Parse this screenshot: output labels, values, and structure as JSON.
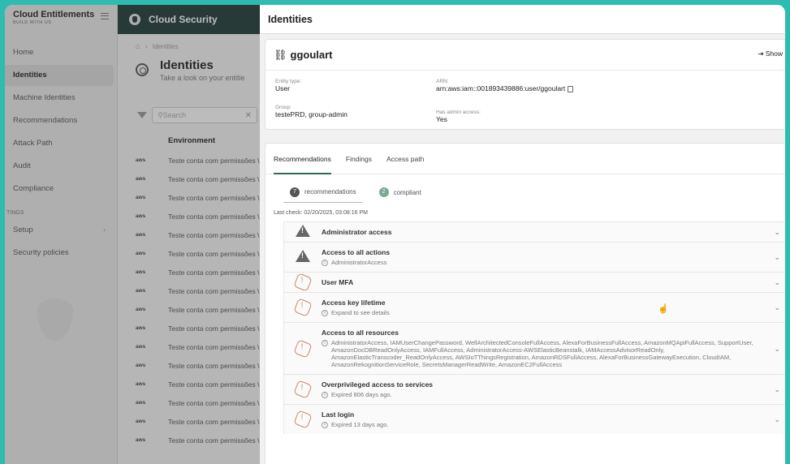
{
  "sidebar": {
    "brand_title": "Cloud Entitlements",
    "brand_subtitle": "BUILD WITH US",
    "items": [
      {
        "label": "Home"
      },
      {
        "label": "Identities"
      },
      {
        "label": "Machine Identities"
      },
      {
        "label": "Recommendations"
      },
      {
        "label": "Attack Path"
      },
      {
        "label": "Audit"
      },
      {
        "label": "Compliance"
      }
    ],
    "section_label": "TINGS",
    "setup_label": "Setup",
    "security_label": "Security policies"
  },
  "middle": {
    "header_title": "Cloud Security",
    "breadcrumb": "Identities",
    "page_title": "Identities",
    "page_subtitle": "Take a look on your entitie",
    "search_placeholder": "Search",
    "column_header": "Environment",
    "row_provider": "aws",
    "row_text": "Teste conta com permissões \\",
    "row_count": 16
  },
  "drawer": {
    "title": "Identities",
    "entity_name": "ggoulart",
    "show_button": "⇥ Show",
    "entity_type_label": "Entity type:",
    "entity_type": "User",
    "arn_label": "ARN:",
    "arn": "arn:aws:iam::001893439886:user/ggoulart",
    "group_label": "Group:",
    "group": "testePRD, group-admin",
    "admin_label": "Has admin access:",
    "admin": "Yes",
    "tabs": [
      "Recommendations",
      "Findings",
      "Access path"
    ],
    "pill_recommendations_count": "7",
    "pill_recommendations_label": "recommendations",
    "pill_compliant_count": "2",
    "pill_compliant_label": "compliant",
    "last_check": "Last check: 02/20/2025, 03:08:16 PM",
    "recommendations": [
      {
        "title": "Administrator access",
        "subtitle": "",
        "icon": "warning-icon"
      },
      {
        "title": "Access to all actions",
        "subtitle": "AdministratorAccess",
        "icon": "warning-icon"
      },
      {
        "title": "User MFA",
        "subtitle": "",
        "icon": "alert-octagon-icon"
      },
      {
        "title": "Access key lifetime",
        "subtitle": "Expand to see details",
        "icon": "alert-octagon-icon"
      },
      {
        "title": "Access to all resources",
        "subtitle": "AdministratorAccess, IAMUserChangePassword, WellArchitectedConsoleFullAccess, AlexaForBusinessFullAccess, AmazonMQApiFullAccess, SupportUser, AmazonDocDBReadOnlyAccess, IAMFullAccess, AdministratorAccess-AWSElasticBeanstalk, IAMAccessAdvisorReadOnly, AmazonElasticTranscoder_ReadOnlyAccess, AWSIoTThingsRegistration, AmazonRDSFullAccess, AlexaForBusinessGatewayExecution, CloudIAM, AmazonRekognitionServiceRole, SecretsManagerReadWrite, AmazonEC2FullAccess",
        "icon": "alert-octagon-icon"
      },
      {
        "title": "Overprivileged access to services",
        "subtitle": "Expired 806 days ago.",
        "icon": "alert-octagon-icon"
      },
      {
        "title": "Last login",
        "subtitle": "Expired 13 days ago.",
        "icon": "alert-octagon-icon"
      }
    ]
  }
}
